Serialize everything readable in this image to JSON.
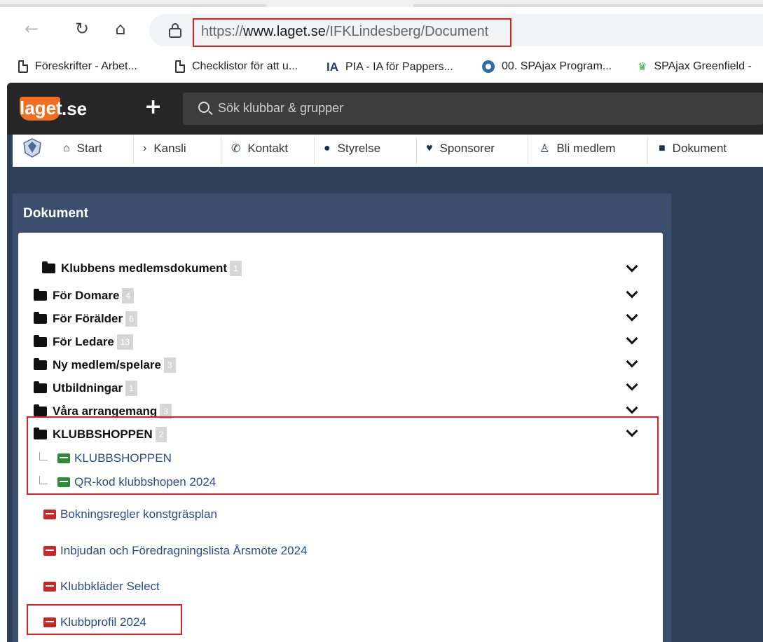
{
  "browser": {
    "url_prefix": "https://",
    "url_domain": "www.laget.se",
    "url_path": "/IFKLindesberg/Document"
  },
  "bookmarks": [
    {
      "label": "Föreskrifter - Arbet...",
      "icon": "document-icon"
    },
    {
      "label": "Checklistor för att u...",
      "icon": "document-icon"
    },
    {
      "label": "PIA - IA för Pappers...",
      "icon": "ia-logo-icon"
    },
    {
      "label": "00. SPAjax Program...",
      "icon": "q-logo-icon"
    },
    {
      "label": "SPAjax Greenfield -",
      "icon": "crown-icon"
    }
  ],
  "app": {
    "logo_prefix": "laget",
    "logo_suffix": ".se",
    "search_placeholder": "Sök klubbar & grupper"
  },
  "club_nav": [
    {
      "label": "Start",
      "icon": "home-icon"
    },
    {
      "label": "Kansli",
      "icon": "chevron-right-icon"
    },
    {
      "label": "Kontakt",
      "icon": "phone-icon"
    },
    {
      "label": "Styrelse",
      "icon": "user-icon"
    },
    {
      "label": "Sponsorer",
      "icon": "heart-icon"
    },
    {
      "label": "Bli medlem",
      "icon": "person-icon"
    },
    {
      "label": "Dokument",
      "icon": "file-icon"
    }
  ],
  "documents": {
    "title": "Dokument",
    "folders": [
      {
        "name": "Klubbens medlemsdokument",
        "count": "1"
      },
      {
        "name": "För Domare",
        "count": "4"
      },
      {
        "name": "För Förälder",
        "count": "6"
      },
      {
        "name": "För Ledare",
        "count": "13"
      },
      {
        "name": "Ny medlem/spelare",
        "count": "3"
      },
      {
        "name": "Utbildningar",
        "count": "1"
      },
      {
        "name": "Våra arrangemang",
        "count": "3"
      },
      {
        "name": "KLUBBSHOPPEN",
        "count": "2"
      }
    ],
    "klubbshoppen_files": [
      "KLUBBSHOPPEN",
      "QR-kod klubbshopen 2024"
    ],
    "files": [
      "Bokningsregler konstgräsplan",
      "Inbjudan och Föredragningslista Årsmöte 2024",
      "Klubbkläder Select",
      "Klubbprofil 2024"
    ]
  },
  "colors": {
    "accent": "#f26f21",
    "highlight": "#e02020",
    "link": "#2a4c82",
    "topbar": "#262626",
    "background": "#2f405a"
  }
}
